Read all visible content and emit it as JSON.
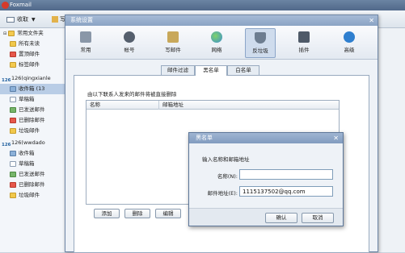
{
  "app": {
    "title": "Foxmail",
    "logo_icon": "foxmail-logo-icon"
  },
  "toolbar": {
    "receive_label": "收取",
    "compose_label": "写"
  },
  "sidebar": {
    "common_folder": "常用文件夹",
    "items": [
      {
        "label": "所有未读",
        "icon": "unread-icon"
      },
      {
        "label": "置顶邮件",
        "icon": "pin-icon"
      },
      {
        "label": "标签邮件",
        "icon": "tag-icon"
      }
    ],
    "account1": {
      "label": "126(qingxianle",
      "badge": "126"
    },
    "account1_items": [
      {
        "label": "收件箱 (13",
        "icon": "inbox-icon"
      },
      {
        "label": "草稿箱",
        "icon": "draft-icon"
      },
      {
        "label": "已发送邮件",
        "icon": "sent-icon"
      },
      {
        "label": "已删除邮件",
        "icon": "trash-icon"
      },
      {
        "label": "垃圾邮件",
        "icon": "spam-icon"
      }
    ],
    "account2": {
      "label": "126(wwdado",
      "badge": "126"
    },
    "account2_items": [
      {
        "label": "收件箱",
        "icon": "inbox-icon"
      },
      {
        "label": "草稿箱",
        "icon": "draft-icon"
      },
      {
        "label": "已发送邮件",
        "icon": "sent-icon"
      },
      {
        "label": "已删除邮件",
        "icon": "trash-icon"
      },
      {
        "label": "垃圾邮件",
        "icon": "spam-icon"
      }
    ]
  },
  "settings": {
    "title": "系统设置",
    "categories": [
      {
        "label": "常用",
        "icon": "common-icon",
        "color": "#8a97a8"
      },
      {
        "label": "帐号",
        "icon": "account-icon",
        "color": "#555f6d"
      },
      {
        "label": "写邮件",
        "icon": "compose-icon",
        "color": "#c8a85a"
      },
      {
        "label": "网络",
        "icon": "network-icon",
        "color": "#3c8fd1"
      },
      {
        "label": "反垃圾",
        "icon": "shield-icon",
        "color": "#6d7d90"
      },
      {
        "label": "插件",
        "icon": "plugin-icon",
        "color": "#4f5a68"
      },
      {
        "label": "高级",
        "icon": "gear-icon",
        "color": "#2f7fcf"
      }
    ],
    "selected_category": "反垃圾",
    "tabs": [
      "邮件过滤",
      "黑名单",
      "白名单"
    ],
    "selected_tab": "黑名单",
    "description": "由以下联系人发来的邮件将被直接删除",
    "columns": [
      "名称",
      "邮箱地址"
    ],
    "buttons": {
      "add": "添加",
      "delete": "删除",
      "edit": "编辑"
    }
  },
  "blacklist_dialog": {
    "title": "黑名单",
    "prompt": "输入名称和邮箱地址",
    "name_label": "名称(N):",
    "name_value": "",
    "email_label": "邮件地址(E):",
    "email_value": "1115137502@qq.com",
    "ok_label": "确认",
    "cancel_label": "取消"
  }
}
